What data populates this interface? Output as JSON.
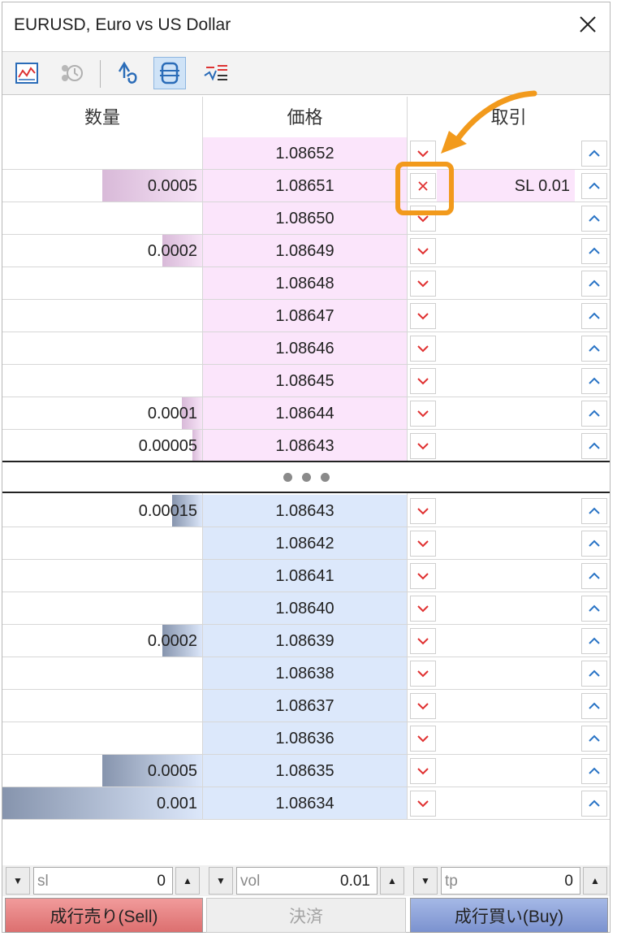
{
  "window": {
    "title": "EURUSD, Euro vs US Dollar"
  },
  "toolbar": {
    "buttons": [
      {
        "name": "chart-icon"
      },
      {
        "name": "history-icon"
      },
      {
        "name": "one-click-trading-icon"
      },
      {
        "name": "depth-of-market-icon"
      },
      {
        "name": "tick-chart-icon"
      }
    ]
  },
  "header": {
    "volume": "数量",
    "price": "価格",
    "trade": "取引"
  },
  "ask_rows": [
    {
      "volume": "",
      "price": "1.08652",
      "bar_fraction": 0
    },
    {
      "volume": "0.0005",
      "price": "1.08651",
      "bar_fraction": 0.5,
      "order": "SL 0.01",
      "cancel": true
    },
    {
      "volume": "",
      "price": "1.08650",
      "bar_fraction": 0
    },
    {
      "volume": "0.0002",
      "price": "1.08649",
      "bar_fraction": 0.2
    },
    {
      "volume": "",
      "price": "1.08648",
      "bar_fraction": 0
    },
    {
      "volume": "",
      "price": "1.08647",
      "bar_fraction": 0
    },
    {
      "volume": "",
      "price": "1.08646",
      "bar_fraction": 0
    },
    {
      "volume": "",
      "price": "1.08645",
      "bar_fraction": 0
    },
    {
      "volume": "0.0001",
      "price": "1.08644",
      "bar_fraction": 0.1
    },
    {
      "volume": "0.00005",
      "price": "1.08643",
      "bar_fraction": 0.05
    }
  ],
  "bid_rows": [
    {
      "volume": "0.00015",
      "price": "1.08643",
      "bar_fraction": 0.15
    },
    {
      "volume": "",
      "price": "1.08642",
      "bar_fraction": 0
    },
    {
      "volume": "",
      "price": "1.08641",
      "bar_fraction": 0
    },
    {
      "volume": "",
      "price": "1.08640",
      "bar_fraction": 0
    },
    {
      "volume": "0.0002",
      "price": "1.08639",
      "bar_fraction": 0.2
    },
    {
      "volume": "",
      "price": "1.08638",
      "bar_fraction": 0
    },
    {
      "volume": "",
      "price": "1.08637",
      "bar_fraction": 0
    },
    {
      "volume": "",
      "price": "1.08636",
      "bar_fraction": 0
    },
    {
      "volume": "0.0005",
      "price": "1.08635",
      "bar_fraction": 0.5
    },
    {
      "volume": "0.001",
      "price": "1.08634",
      "bar_fraction": 1.0
    }
  ],
  "inputs": {
    "sl": {
      "label": "sl",
      "value": "0"
    },
    "vol": {
      "label": "vol",
      "value": "0.01"
    },
    "tp": {
      "label": "tp",
      "value": "0"
    }
  },
  "actions": {
    "sell": "成行売り(Sell)",
    "close": "決済",
    "buy": "成行買い(Buy)"
  },
  "colors": {
    "ask_bg": "#fbe5fb",
    "bid_bg": "#dce8fb",
    "highlight": "#f29a1c",
    "sell": "#dc6f6f",
    "buy": "#7b92cf",
    "down_arrow": "#e03030",
    "up_arrow": "#2a74c6"
  }
}
